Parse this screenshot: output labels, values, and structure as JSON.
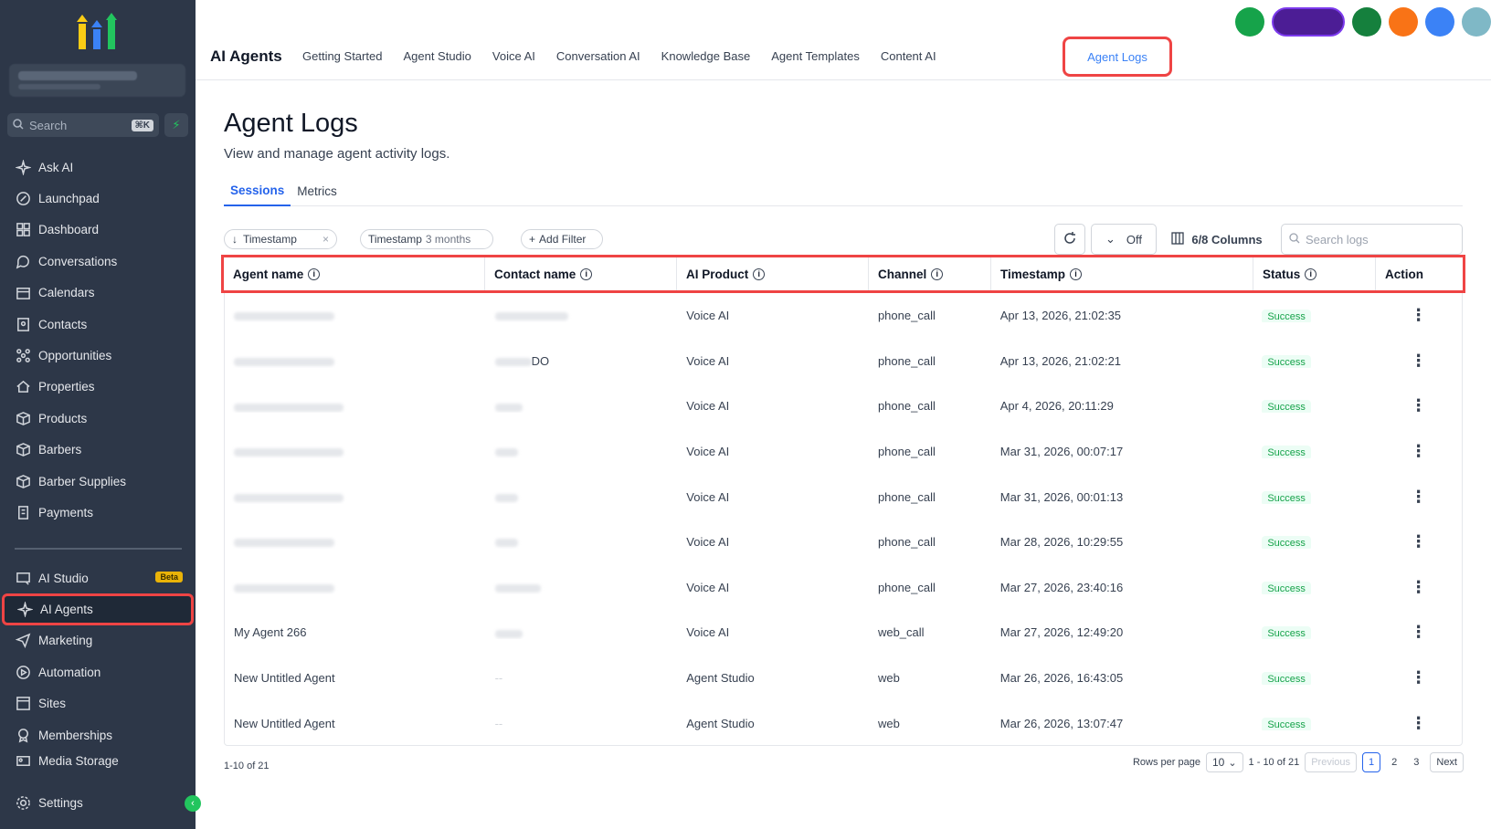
{
  "sidebar": {
    "search_label": "Search",
    "search_shortcut": "⌘K",
    "items": [
      {
        "label": "Ask AI",
        "icon": "sparkle-icon"
      },
      {
        "label": "Launchpad",
        "icon": "rocket-icon"
      },
      {
        "label": "Dashboard",
        "icon": "grid-icon"
      },
      {
        "label": "Conversations",
        "icon": "chat-icon"
      },
      {
        "label": "Calendars",
        "icon": "calendar-icon"
      },
      {
        "label": "Contacts",
        "icon": "contacts-icon"
      },
      {
        "label": "Opportunities",
        "icon": "opportunities-icon"
      },
      {
        "label": "Properties",
        "icon": "home-icon"
      },
      {
        "label": "Products",
        "icon": "box-icon"
      },
      {
        "label": "Barbers",
        "icon": "box-icon"
      },
      {
        "label": "Barber Supplies",
        "icon": "box-icon"
      },
      {
        "label": "Payments",
        "icon": "receipt-icon"
      }
    ],
    "items2": [
      {
        "label": "AI Studio",
        "icon": "ai-studio-icon",
        "badge": "Beta"
      },
      {
        "label": "AI Agents",
        "icon": "sparkle-icon",
        "active": true
      },
      {
        "label": "Marketing",
        "icon": "send-icon"
      },
      {
        "label": "Automation",
        "icon": "automation-icon"
      },
      {
        "label": "Sites",
        "icon": "sites-icon"
      },
      {
        "label": "Memberships",
        "icon": "membership-icon"
      },
      {
        "label": "Media Storage",
        "icon": "media-icon"
      }
    ],
    "settings_label": "Settings"
  },
  "header": {
    "app_title": "AI Agents",
    "tabs": [
      "Getting Started",
      "Agent Studio",
      "Voice AI",
      "Conversation AI",
      "Knowledge Base",
      "Agent Templates",
      "Content AI"
    ],
    "active_tab": "Agent Logs"
  },
  "page": {
    "title": "Agent Logs",
    "subtitle": "View and manage agent activity logs.",
    "subtabs": [
      "Sessions",
      "Metrics"
    ]
  },
  "filters": {
    "chip1": "Timestamp",
    "chip2_label": "Timestamp",
    "chip2_value": "3 months",
    "add_filter": "Add Filter",
    "refresh_off": "Off",
    "columns": "6/8 Columns",
    "search_placeholder": "Search logs"
  },
  "table": {
    "columns": [
      "Agent name",
      "Contact name",
      "AI Product",
      "Channel",
      "Timestamp",
      "Status",
      "Action"
    ],
    "rows": [
      {
        "agent": "",
        "contact": "",
        "contact_suffix": "",
        "product": "Voice AI",
        "channel": "phone_call",
        "timestamp": "Apr 13, 2026, 21:02:35",
        "status": "Success"
      },
      {
        "agent": "",
        "contact": "",
        "contact_suffix": "DO",
        "product": "Voice AI",
        "channel": "phone_call",
        "timestamp": "Apr 13, 2026, 21:02:21",
        "status": "Success"
      },
      {
        "agent": "",
        "contact": "",
        "contact_suffix": "",
        "product": "Voice AI",
        "channel": "phone_call",
        "timestamp": "Apr 4, 2026, 20:11:29",
        "status": "Success"
      },
      {
        "agent": "",
        "contact": "",
        "contact_suffix": "",
        "product": "Voice AI",
        "channel": "phone_call",
        "timestamp": "Mar 31, 2026, 00:07:17",
        "status": "Success"
      },
      {
        "agent": "",
        "contact": "",
        "contact_suffix": "",
        "product": "Voice AI",
        "channel": "phone_call",
        "timestamp": "Mar 31, 2026, 00:01:13",
        "status": "Success"
      },
      {
        "agent": "",
        "contact": "",
        "contact_suffix": "",
        "product": "Voice AI",
        "channel": "phone_call",
        "timestamp": "Mar 28, 2026, 10:29:55",
        "status": "Success"
      },
      {
        "agent": "",
        "contact": "",
        "contact_suffix": "",
        "product": "Voice AI",
        "channel": "phone_call",
        "timestamp": "Mar 27, 2026, 23:40:16",
        "status": "Success"
      },
      {
        "agent": "My Agent 266",
        "contact": "",
        "contact_suffix": "",
        "product": "Voice AI",
        "channel": "web_call",
        "timestamp": "Mar 27, 2026, 12:49:20",
        "status": "Success"
      },
      {
        "agent": "New Untitled Agent",
        "contact": "--",
        "contact_suffix": "",
        "product": "Agent Studio",
        "channel": "web",
        "timestamp": "Mar 26, 2026, 16:43:05",
        "status": "Success"
      },
      {
        "agent": "New Untitled Agent",
        "contact": "--",
        "contact_suffix": "",
        "product": "Agent Studio",
        "channel": "web",
        "timestamp": "Mar 26, 2026, 13:07:47",
        "status": "Success"
      }
    ]
  },
  "pagination": {
    "summary": "1-10 of 21",
    "rows_per_page_label": "Rows per page",
    "rows_per_page": "10",
    "range": "1 - 10 of 21",
    "previous": "Previous",
    "pages": [
      "1",
      "2",
      "3"
    ],
    "next": "Next"
  },
  "colors": {
    "sidebar_bg": "#2d3748",
    "highlight": "#ef4444",
    "accent": "#2563eb",
    "success": "#16a34a"
  }
}
